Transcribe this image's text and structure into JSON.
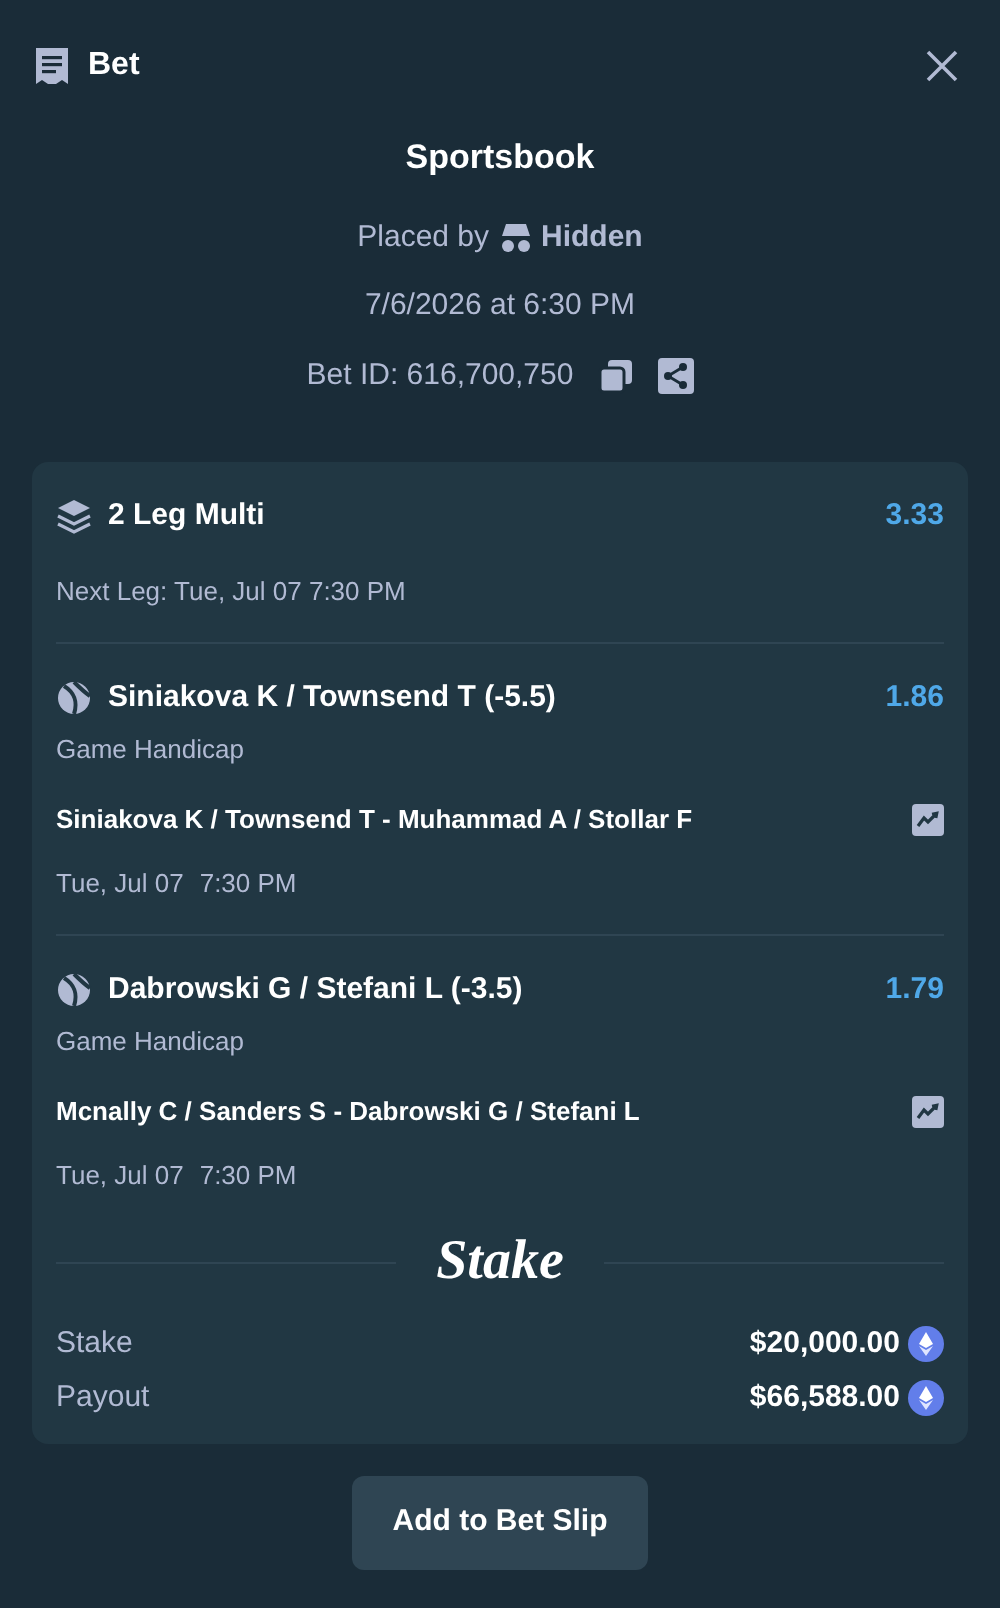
{
  "header": {
    "title": "Bet"
  },
  "summary": {
    "title": "Sportsbook",
    "placed_by_label": "Placed by",
    "placed_by_user": "Hidden",
    "date": "7/6/2026 at 6:30 PM",
    "bet_id": "Bet ID: 616,700,750"
  },
  "multi": {
    "title": "2 Leg Multi",
    "odds": "3.33",
    "next_leg": "Next Leg: Tue, Jul 07 7:30 PM"
  },
  "legs": [
    {
      "selection": "Siniakova K / Townsend T (-5.5)",
      "odds": "1.86",
      "market": "Game Handicap",
      "match": "Siniakova K / Townsend T - Muhammad A / Stollar F",
      "date": "Tue, Jul 07",
      "time": "7:30 PM"
    },
    {
      "selection": "Dabrowski G / Stefani L (-3.5)",
      "odds": "1.79",
      "market": "Game Handicap",
      "match": "Mcnally C / Sanders S - Dabrowski G / Stefani L",
      "date": "Tue, Jul 07",
      "time": "7:30 PM"
    }
  ],
  "logo": "Stake",
  "totals": [
    {
      "label": "Stake",
      "value": "$20,000.00"
    },
    {
      "label": "Payout",
      "value": "$66,588.00"
    }
  ],
  "button": "Add to Bet Slip"
}
